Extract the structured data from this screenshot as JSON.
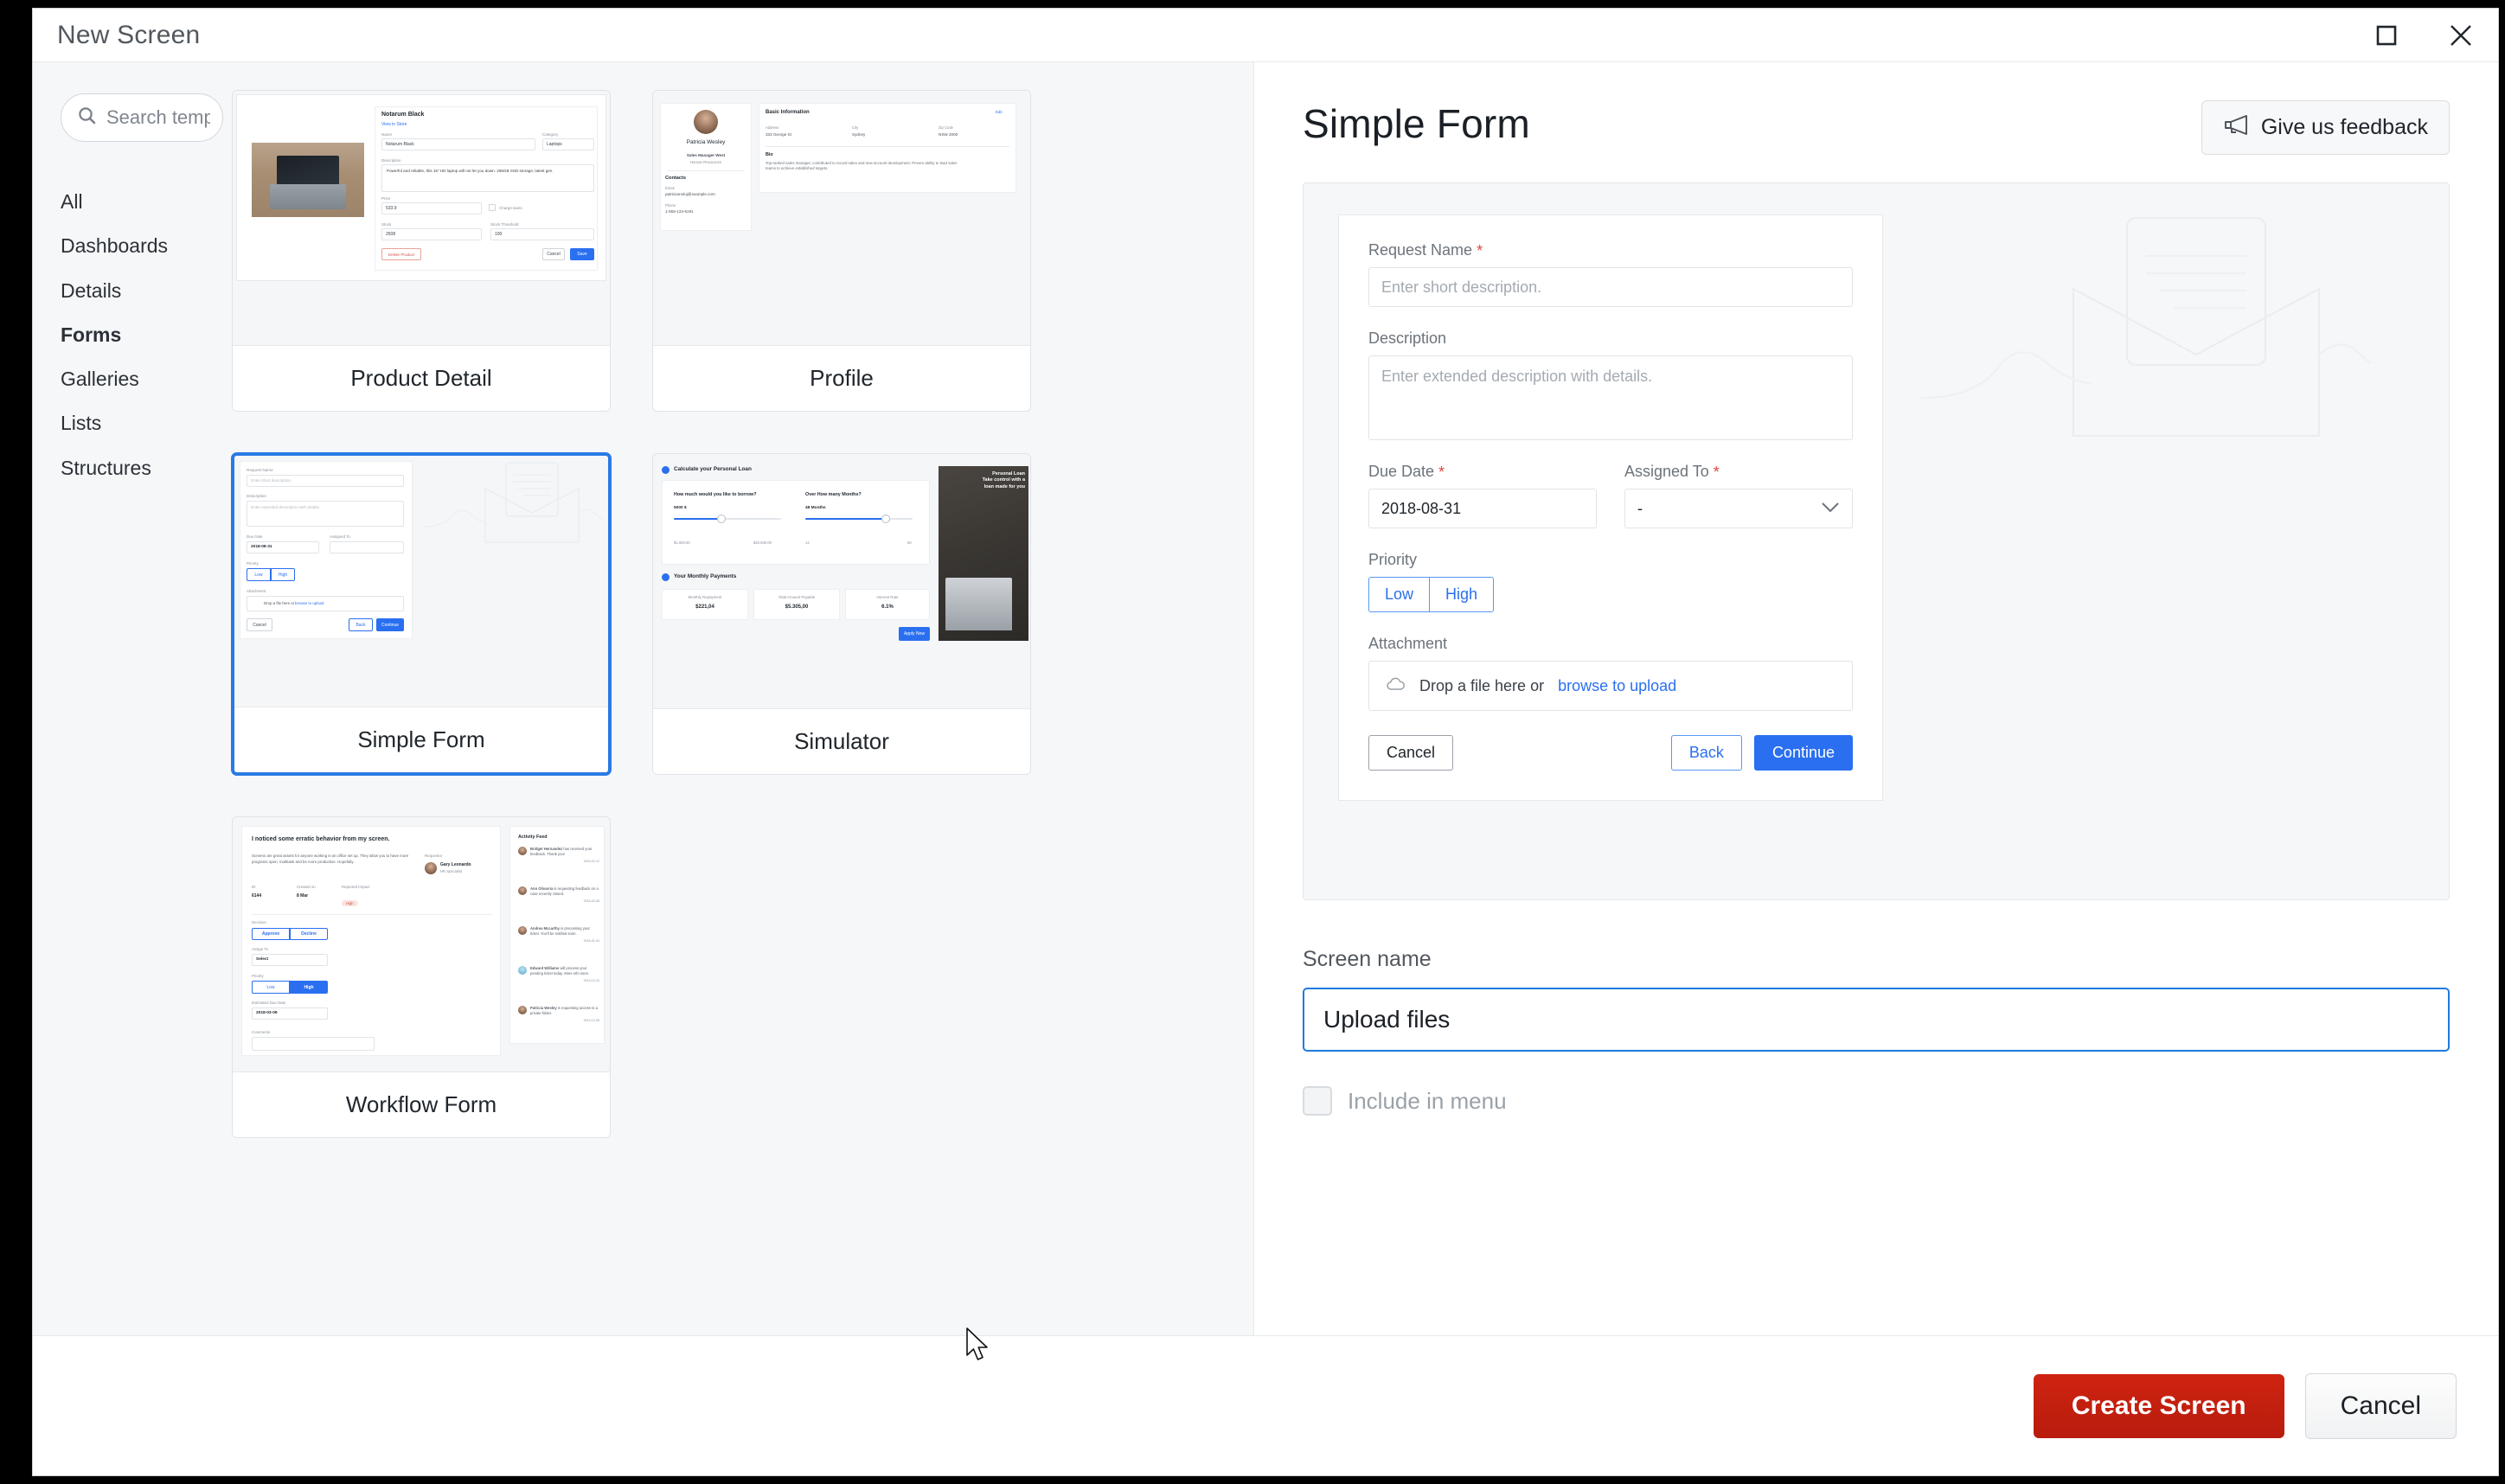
{
  "window": {
    "title": "New Screen",
    "maximize_icon": "maximize-icon",
    "close_icon": "close-icon"
  },
  "sidebar": {
    "search": {
      "placeholder": "Search template",
      "value": "",
      "icon": "search-icon"
    },
    "categories": [
      {
        "label": "All",
        "active": false
      },
      {
        "label": "Dashboards",
        "active": false
      },
      {
        "label": "Details",
        "active": false
      },
      {
        "label": "Forms",
        "active": true
      },
      {
        "label": "Galleries",
        "active": false
      },
      {
        "label": "Lists",
        "active": false
      },
      {
        "label": "Structures",
        "active": false
      }
    ]
  },
  "templates": [
    {
      "label": "Product Detail",
      "selected": false
    },
    {
      "label": "Profile",
      "selected": false
    },
    {
      "label": "Simple Form",
      "selected": true
    },
    {
      "label": "Simulator",
      "selected": false
    },
    {
      "label": "Workflow Form",
      "selected": false
    }
  ],
  "thumbnails": {
    "product_detail": {
      "title": "Notarum Black",
      "view_in_store": "View in Store",
      "name_label": "Name",
      "name_value": "Notarum Black",
      "category_label": "Category",
      "category_value": "Laptops",
      "description_label": "Description",
      "description_value": "Powerful and reliable, this 15\" HD laptop will not let you down. 256GB SSD storage, latest gen.",
      "price_label": "Price",
      "price_value": "533.9",
      "charge_taxes_label": "Charge taxes",
      "stock_label": "Stock",
      "stock_value": "2508",
      "stock_threshold_label": "Stock Threshold",
      "stock_threshold_value": "100",
      "delete_label": "Delete Product",
      "cancel_label": "Cancel",
      "save_label": "Save"
    },
    "profile": {
      "name": "Patricia Wesley",
      "role": "Sales Manager West",
      "department": "Human Resources",
      "contacts_heading": "Contacts",
      "email_label": "Email",
      "email_value": "patriciamoluj@example.com",
      "phone_label": "Phone",
      "phone_value": "1-555-123-5191",
      "basic_info_heading": "Basic Information",
      "edit_label": "Edit",
      "address_label": "Address",
      "address_value": "333 George St",
      "city_label": "City",
      "city_value": "Sydney",
      "zip_label": "Zip Code",
      "zip_value": "NSW 2000",
      "bio_label": "Bio",
      "bio_value": "Top-ranked sales manager, contributed to record sales and new account development. Proven ability to lead sales teams to achieve established targets."
    },
    "simulator": {
      "section1": "Calculate your Personal Loan",
      "q1": "How much would you like to borrow?",
      "q1_value": "5000 $",
      "q1_min": "$1.000,00",
      "q1_max": "$10.000,00",
      "q2": "Over How many Months?",
      "q2_value": "48 Months",
      "q2_min": "12",
      "q2_max": "60",
      "section2": "Your Monthly Payments",
      "stat1_label": "Monthly Repayment",
      "stat1_value": "$221,04",
      "stat2_label": "Total Amount Payable",
      "stat2_value": "$5.305,00",
      "stat3_label": "Interest Rate",
      "stat3_value": "6.1%",
      "apply_label": "Apply Now",
      "promo_line1": "Personal Loan",
      "promo_line2": "Take control with a",
      "promo_line3": "loan made for you"
    },
    "workflow": {
      "title": "I noticed some erratic behavior from my screen.",
      "body": "Screens are great assets for anyone working in an office set up. They allow you to have more programs open, multitask and be more productive. Hopefully.",
      "requestor_label": "Requestor",
      "requestor_name": "Gary Leonardo",
      "requestor_role": "HR Specialist",
      "id_label": "ID",
      "id_value": "6144",
      "created_label": "Created on",
      "created_value": "8 Mar",
      "impact_label": "Reported Impact",
      "impact_value": "High",
      "decision_label": "Decision",
      "approve_label": "Approve",
      "decline_label": "Decline",
      "assign_label": "Assign To",
      "assign_value": "Select",
      "priority_label": "Priority",
      "priority_low": "Low",
      "priority_high": "High",
      "due_label": "Estimated Due Date",
      "due_value": "2018-03-09",
      "comments_label": "Comments",
      "feed_heading": "Activity Feed",
      "feed": [
        {
          "name": "Bridget Hernandez",
          "text": " has received your feedback. Thank you!",
          "date": "2016-02-12"
        },
        {
          "name": "Ann Olivarria",
          "text": " is requesting feedback on a case recently closed.",
          "date": "2016-02-06"
        },
        {
          "name": "Andrea Mccarthy",
          "text": " is processing your ticket. You'll be notified soon.",
          "date": "2016-01-04"
        },
        {
          "name": "Edward Williams",
          "text": " will process your pending ticket today. More info soon.",
          "date": "2015-12-24"
        },
        {
          "name": "Patricia Wesley",
          "text": " is requesting access to a private folder.",
          "date": "2015-12-05"
        }
      ]
    }
  },
  "preview": {
    "title": "Simple Form",
    "feedback_button": "Give us feedback",
    "feedback_icon": "megaphone-icon",
    "form": {
      "request_name_label": "Request Name",
      "request_name_required": "*",
      "request_name_placeholder": "Enter short description.",
      "description_label": "Description",
      "description_placeholder": "Enter extended description with details.",
      "due_date_label": "Due Date",
      "due_date_required": "*",
      "due_date_value": "2018-08-31",
      "assigned_to_label": "Assigned To",
      "assigned_to_required": "*",
      "assigned_to_value": "-",
      "priority_label": "Priority",
      "priority_low": "Low",
      "priority_high": "High",
      "attachment_label": "Attachment",
      "attachment_icon": "cloud-upload-icon",
      "attachment_text": "Drop a file here or",
      "attachment_link": "browse to upload",
      "cancel_label": "Cancel",
      "back_label": "Back",
      "continue_label": "Continue"
    }
  },
  "screen_form": {
    "name_label": "Screen name",
    "name_value": "Upload files",
    "include_in_menu_label": "Include in menu",
    "include_in_menu_checked": false
  },
  "footer": {
    "create_label": "Create Screen",
    "cancel_label": "Cancel"
  },
  "colors": {
    "primary_red": "#c41f0d",
    "accent_blue": "#2a6ff0",
    "focus_blue": "#1f7ae0",
    "required_red": "#e0483c",
    "panel_bg": "#f6f7f9"
  }
}
